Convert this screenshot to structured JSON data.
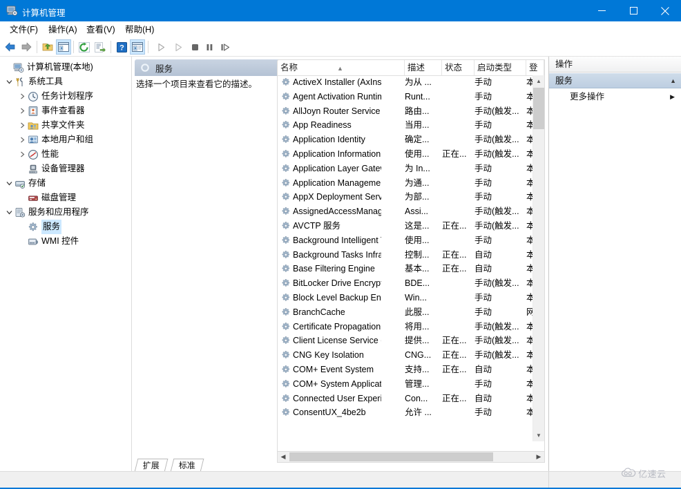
{
  "window": {
    "title": "计算机管理",
    "icon": "computer-management-icon",
    "minimize_label": "最小化",
    "maximize_label": "最大化",
    "close_label": "关闭"
  },
  "menubar": [
    {
      "label": "文件(F)",
      "name": "menu-file"
    },
    {
      "label": "操作(A)",
      "name": "menu-action"
    },
    {
      "label": "查看(V)",
      "name": "menu-view"
    },
    {
      "label": "帮助(H)",
      "name": "menu-help"
    }
  ],
  "toolbar": [
    {
      "name": "back-button",
      "icon": "arrow-left-icon",
      "enabled": true
    },
    {
      "name": "forward-button",
      "icon": "arrow-right-icon",
      "enabled": true
    },
    {
      "name": "up-one-level-button",
      "icon": "folder-up-icon",
      "enabled": true
    },
    {
      "name": "show-hide-tree-button",
      "icon": "show-tree-icon",
      "enabled": true,
      "pressed": true
    },
    {
      "name": "refresh-button",
      "icon": "refresh-icon",
      "enabled": true
    },
    {
      "name": "export-list-button",
      "icon": "export-list-icon",
      "enabled": true
    },
    {
      "name": "help-button",
      "icon": "help-icon",
      "enabled": true
    },
    {
      "name": "properties-button",
      "icon": "properties-icon",
      "enabled": true,
      "pressed": true
    },
    {
      "name": "start-service-button",
      "icon": "play-icon",
      "enabled": false
    },
    {
      "name": "resume-service-button",
      "icon": "play-outline-icon",
      "enabled": false
    },
    {
      "name": "stop-service-button",
      "icon": "stop-icon",
      "enabled": false
    },
    {
      "name": "pause-service-button",
      "icon": "pause-icon",
      "enabled": false
    },
    {
      "name": "restart-service-button",
      "icon": "restart-icon",
      "enabled": false
    }
  ],
  "tree": [
    {
      "label": "计算机管理(本地)",
      "icon": "computer-icon",
      "depth": 0,
      "expander": "none",
      "selected": false
    },
    {
      "label": "系统工具",
      "icon": "system-tools-icon",
      "depth": 1,
      "expander": "expanded",
      "selected": false
    },
    {
      "label": "任务计划程序",
      "icon": "task-scheduler-icon",
      "depth": 2,
      "expander": "collapsed",
      "selected": false
    },
    {
      "label": "事件查看器",
      "icon": "event-viewer-icon",
      "depth": 2,
      "expander": "collapsed",
      "selected": false
    },
    {
      "label": "共享文件夹",
      "icon": "shared-folders-icon",
      "depth": 2,
      "expander": "collapsed",
      "selected": false
    },
    {
      "label": "本地用户和组",
      "icon": "local-users-groups-icon",
      "depth": 2,
      "expander": "collapsed",
      "selected": false
    },
    {
      "label": "性能",
      "icon": "performance-icon",
      "depth": 2,
      "expander": "collapsed",
      "selected": false
    },
    {
      "label": "设备管理器",
      "icon": "device-manager-icon",
      "depth": 2,
      "expander": "none",
      "selected": false
    },
    {
      "label": "存储",
      "icon": "storage-icon",
      "depth": 1,
      "expander": "expanded",
      "selected": false
    },
    {
      "label": "磁盘管理",
      "icon": "disk-management-icon",
      "depth": 2,
      "expander": "none",
      "selected": false
    },
    {
      "label": "服务和应用程序",
      "icon": "services-applications-icon",
      "depth": 1,
      "expander": "expanded",
      "selected": false
    },
    {
      "label": "服务",
      "icon": "services-icon",
      "depth": 2,
      "expander": "none",
      "selected": true
    },
    {
      "label": "WMI 控件",
      "icon": "wmi-control-icon",
      "depth": 2,
      "expander": "none",
      "selected": false
    }
  ],
  "description_pane": {
    "header_title": "服务",
    "header_icon": "services-gear-icon",
    "body_text": "选择一个项目来查看它的描述。"
  },
  "list": {
    "columns": [
      {
        "label": "名称",
        "name": "column-name",
        "sorted": "asc"
      },
      {
        "label": "描述",
        "name": "column-description"
      },
      {
        "label": "状态",
        "name": "column-status"
      },
      {
        "label": "启动类型",
        "name": "column-startup-type"
      },
      {
        "label": "登",
        "name": "column-logon-as"
      }
    ],
    "rows": [
      {
        "name": "ActiveX Installer (AxInstSV)",
        "description": "为从 ...",
        "status": "",
        "startup": "手动",
        "logon": "本"
      },
      {
        "name": "Agent Activation Runtime...",
        "description": "Runt...",
        "status": "",
        "startup": "手动",
        "logon": "本"
      },
      {
        "name": "AllJoyn Router Service",
        "description": "路由...",
        "status": "",
        "startup": "手动(触发...",
        "logon": "本"
      },
      {
        "name": "App Readiness",
        "description": "当用...",
        "status": "",
        "startup": "手动",
        "logon": "本"
      },
      {
        "name": "Application Identity",
        "description": "确定...",
        "status": "",
        "startup": "手动(触发...",
        "logon": "本"
      },
      {
        "name": "Application Information",
        "description": "使用...",
        "status": "正在...",
        "startup": "手动(触发...",
        "logon": "本"
      },
      {
        "name": "Application Layer Gatewa...",
        "description": "为 In...",
        "status": "",
        "startup": "手动",
        "logon": "本"
      },
      {
        "name": "Application Management",
        "description": "为通...",
        "status": "",
        "startup": "手动",
        "logon": "本"
      },
      {
        "name": "AppX Deployment Servic...",
        "description": "为部...",
        "status": "",
        "startup": "手动",
        "logon": "本"
      },
      {
        "name": "AssignedAccessManager...",
        "description": "Assi...",
        "status": "",
        "startup": "手动(触发...",
        "logon": "本"
      },
      {
        "name": "AVCTP 服务",
        "description": "这是...",
        "status": "正在...",
        "startup": "手动(触发...",
        "logon": "本"
      },
      {
        "name": "Background Intelligent T...",
        "description": "使用...",
        "status": "",
        "startup": "手动",
        "logon": "本"
      },
      {
        "name": "Background Tasks Infras...",
        "description": "控制...",
        "status": "正在...",
        "startup": "自动",
        "logon": "本"
      },
      {
        "name": "Base Filtering Engine",
        "description": "基本...",
        "status": "正在...",
        "startup": "自动",
        "logon": "本"
      },
      {
        "name": "BitLocker Drive Encryptio...",
        "description": "BDE...",
        "status": "",
        "startup": "手动(触发...",
        "logon": "本"
      },
      {
        "name": "Block Level Backup Engi...",
        "description": "Win...",
        "status": "",
        "startup": "手动",
        "logon": "本"
      },
      {
        "name": "BranchCache",
        "description": "此服...",
        "status": "",
        "startup": "手动",
        "logon": "网"
      },
      {
        "name": "Certificate Propagation",
        "description": "将用...",
        "status": "",
        "startup": "手动(触发...",
        "logon": "本"
      },
      {
        "name": "Client License Service (Cli...",
        "description": "提供...",
        "status": "正在...",
        "startup": "手动(触发...",
        "logon": "本"
      },
      {
        "name": "CNG Key Isolation",
        "description": "CNG...",
        "status": "正在...",
        "startup": "手动(触发...",
        "logon": "本"
      },
      {
        "name": "COM+ Event System",
        "description": "支持...",
        "status": "正在...",
        "startup": "自动",
        "logon": "本"
      },
      {
        "name": "COM+ System Application",
        "description": "管理...",
        "status": "",
        "startup": "手动",
        "logon": "本"
      },
      {
        "name": "Connected User Experien...",
        "description": "Con...",
        "status": "正在...",
        "startup": "自动",
        "logon": "本"
      },
      {
        "name": "ConsentUX_4be2b",
        "description": "允许 ...",
        "status": "",
        "startup": "手动",
        "logon": "本"
      }
    ]
  },
  "tabs": [
    {
      "label": "扩展",
      "name": "tab-extended",
      "active": false
    },
    {
      "label": "标准",
      "name": "tab-standard",
      "active": true
    }
  ],
  "actions": {
    "title": "操作",
    "section_label": "服务",
    "more_actions_label": "更多操作"
  },
  "watermark": {
    "text": "亿速云",
    "icon": "cloud-icon"
  },
  "colors": {
    "titlebar": "#0078d7",
    "selection": "#cce8ff",
    "accent": "#0078d7"
  }
}
